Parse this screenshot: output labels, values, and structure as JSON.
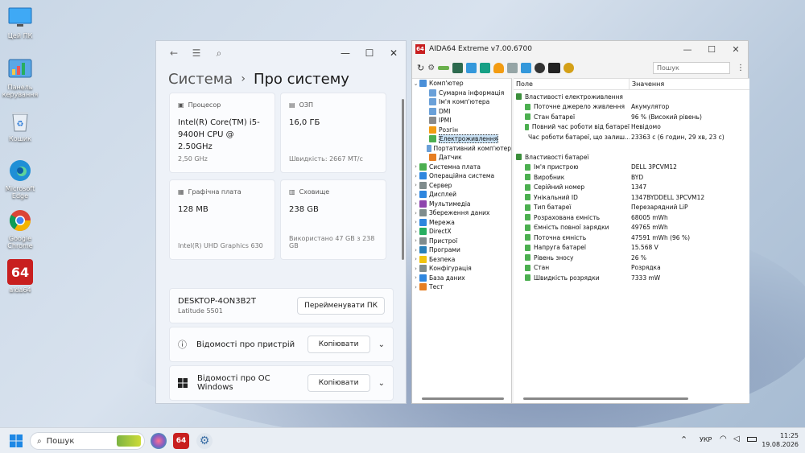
{
  "desktop": {
    "icons": [
      {
        "label": "Цей ПК",
        "icon": "monitor-icon"
      },
      {
        "label": "Панель керування",
        "icon": "control-panel-icon"
      },
      {
        "label": "Кошик",
        "icon": "recycle-bin-icon"
      },
      {
        "label": "Microsoft Edge",
        "icon": "edge-icon"
      },
      {
        "label": "Google Chrome",
        "icon": "chrome-icon"
      },
      {
        "label": "aida64",
        "icon": "aida64-icon"
      }
    ]
  },
  "settings": {
    "breadcrumb_parent": "Система",
    "breadcrumb_current": "Про систему",
    "cards": {
      "cpu": {
        "header": "Процесор",
        "value": "Intel(R) Core(TM) i5-9400H CPU @ 2.50GHz",
        "sub": "2,50 GHz"
      },
      "ram": {
        "header": "ОЗП",
        "value": "16,0 ГБ",
        "sub": "Швидкість: 2667 MT/с"
      },
      "gpu": {
        "header": "Графічна плата",
        "value": "128 MB",
        "sub": "Intel(R) UHD Graphics 630"
      },
      "storage": {
        "header": "Сховище",
        "value": "238 GB",
        "sub": "Використано 47 GB з 238 GB"
      }
    },
    "device_name": "DESKTOP-4ON3B2T",
    "device_model": "Latitude 5501",
    "rename_button": "Перейменувати ПК",
    "device_specs_label": "Відомості про пристрій",
    "windows_specs_label": "Відомості про ОС Windows",
    "copy_button": "Копіювати"
  },
  "aida": {
    "title": "AIDA64 Extreme v7.00.6700",
    "logo": "64",
    "search_placeholder": "Пошук",
    "tree": [
      {
        "label": "Комп'ютер",
        "level": 0,
        "exp": "⌄",
        "color": "#4a8fd8"
      },
      {
        "label": "Сумарна інформація",
        "level": 1,
        "exp": "",
        "color": "#6aa0d8"
      },
      {
        "label": "Ім'я комп'ютера",
        "level": 1,
        "exp": "",
        "color": "#6aa0d8"
      },
      {
        "label": "DMI",
        "level": 1,
        "exp": "",
        "color": "#6aa0d8"
      },
      {
        "label": "IPMI",
        "level": 1,
        "exp": "",
        "color": "#8a8a8a"
      },
      {
        "label": "Розгін",
        "level": 1,
        "exp": "",
        "color": "#f39c12"
      },
      {
        "label": "Електроживлення",
        "level": 1,
        "exp": "",
        "color": "#4caf50",
        "selected": true
      },
      {
        "label": "Портативний комп'ютер",
        "level": 1,
        "exp": "",
        "color": "#6aa0d8"
      },
      {
        "label": "Датчик",
        "level": 1,
        "exp": "",
        "color": "#e67e22"
      },
      {
        "label": "Системна плата",
        "level": 0,
        "exp": "›",
        "color": "#4caf50"
      },
      {
        "label": "Операційна система",
        "level": 0,
        "exp": "›",
        "color": "#2e86de"
      },
      {
        "label": "Сервер",
        "level": 0,
        "exp": "›",
        "color": "#7f8c8d"
      },
      {
        "label": "Дисплей",
        "level": 0,
        "exp": "›",
        "color": "#2e86de"
      },
      {
        "label": "Мультимедіа",
        "level": 0,
        "exp": "›",
        "color": "#8e44ad"
      },
      {
        "label": "Збереження даних",
        "level": 0,
        "exp": "›",
        "color": "#7f8c8d"
      },
      {
        "label": "Мережа",
        "level": 0,
        "exp": "›",
        "color": "#2e86de"
      },
      {
        "label": "DirectX",
        "level": 0,
        "exp": "›",
        "color": "#27ae60"
      },
      {
        "label": "Пристрої",
        "level": 0,
        "exp": "›",
        "color": "#7f8c8d"
      },
      {
        "label": "Програми",
        "level": 0,
        "exp": "›",
        "color": "#2980b9"
      },
      {
        "label": "Безпека",
        "level": 0,
        "exp": "›",
        "color": "#f1c40f"
      },
      {
        "label": "Конфігурація",
        "level": 0,
        "exp": "›",
        "color": "#7f8c8d"
      },
      {
        "label": "База даних",
        "level": 0,
        "exp": "›",
        "color": "#2e86de"
      },
      {
        "label": "Тест",
        "level": 0,
        "exp": "›",
        "color": "#e67e22"
      }
    ],
    "col_field": "Поле",
    "col_value": "Значення",
    "rows": [
      {
        "field": "Властивості електроживлення",
        "value": "",
        "group": true
      },
      {
        "field": "Поточне джерело живлення",
        "value": "Акумулятор"
      },
      {
        "field": "Стан батареї",
        "value": "96 % (Високий рівень)"
      },
      {
        "field": "Повний час роботи від батареї",
        "value": "Невідомо"
      },
      {
        "field": "Час роботи батареї, що залиш...",
        "value": "23363 с (6 годин, 29 хв, 23 с)"
      },
      {
        "field": "",
        "value": "",
        "blank": true
      },
      {
        "field": "Властивості батареї",
        "value": "",
        "group": true
      },
      {
        "field": "Ім'я пристрою",
        "value": "DELL 3PCVM12"
      },
      {
        "field": "Виробник",
        "value": "BYD"
      },
      {
        "field": "Серійний номер",
        "value": "1347"
      },
      {
        "field": "Унікальний ID",
        "value": "1347BYDDELL 3PCVM12"
      },
      {
        "field": "Тип батареї",
        "value": "Перезарядний LiP"
      },
      {
        "field": "Розрахована ємність",
        "value": "68005 mWh"
      },
      {
        "field": "Ємність повної зарядки",
        "value": "49765 mWh"
      },
      {
        "field": "Поточна ємність",
        "value": "47591 mWh  (96 %)"
      },
      {
        "field": "Напруга батареї",
        "value": "15.568 V"
      },
      {
        "field": "Рівень зносу",
        "value": "26 %"
      },
      {
        "field": "Стан",
        "value": "Розрядка"
      },
      {
        "field": "Швидкість розрядки",
        "value": "7333 mW"
      }
    ]
  },
  "taskbar": {
    "search_placeholder": "Пошук",
    "lang": "УКР",
    "time": "11:25",
    "date": "19.08.2026"
  }
}
